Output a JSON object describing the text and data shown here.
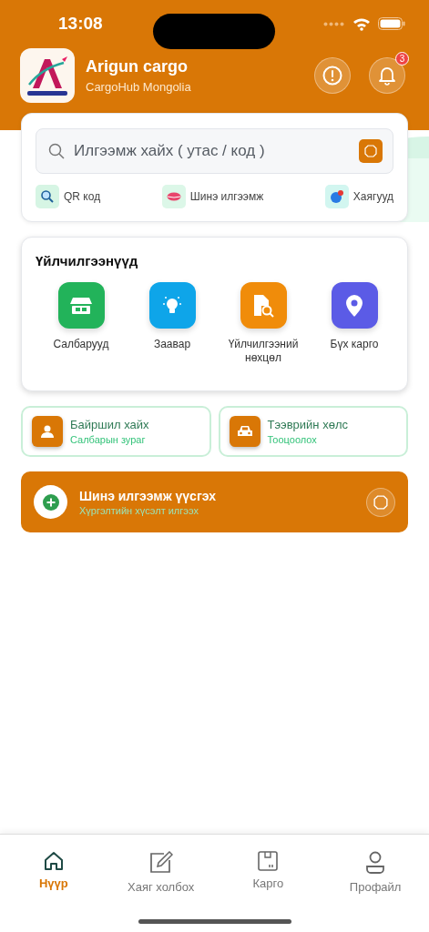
{
  "status_bar": {
    "time": "13:08"
  },
  "header": {
    "title": "Arigun cargo",
    "subtitle": "CargoHub Mongolia",
    "notification_count": "3"
  },
  "search": {
    "placeholder": "Илгээмж хайх ( утас / код )"
  },
  "quick_links": [
    {
      "label": "QR код",
      "kind": "qr"
    },
    {
      "label": "Шинэ илгээмж",
      "kind": "new"
    },
    {
      "label": "Хаягууд",
      "kind": "address"
    }
  ],
  "services": {
    "title": "Үйлчилгээнүүд",
    "items": [
      {
        "label": "Салбарууд",
        "kind": "store",
        "color": "#22b35a"
      },
      {
        "label": "Заавар",
        "kind": "bulb",
        "color": "#0ea5e9"
      },
      {
        "label": "Үйлчилгээний нөхцөл",
        "kind": "doc",
        "color": "#f08c0a"
      },
      {
        "label": "Бүх карго",
        "kind": "pin",
        "color": "#5b5be6"
      }
    ]
  },
  "shortcuts": [
    {
      "title": "Байршил хайх",
      "subtitle": "Салбарын зураг",
      "kind": "person"
    },
    {
      "title": "Тээврийн хөлс",
      "subtitle": "Тооцоолох",
      "kind": "car"
    }
  ],
  "banner": {
    "title": "Шинэ илгээмж үүсгэх",
    "subtitle": "Хүргэлтийн хүсэлт илгээх"
  },
  "nav": [
    {
      "label": "Нүүр",
      "kind": "home",
      "selected": true
    },
    {
      "label": "Хаяг холбох",
      "kind": "edit",
      "selected": false
    },
    {
      "label": "Карго",
      "kind": "box",
      "selected": false
    },
    {
      "label": "Профайл",
      "kind": "user",
      "selected": false
    }
  ]
}
